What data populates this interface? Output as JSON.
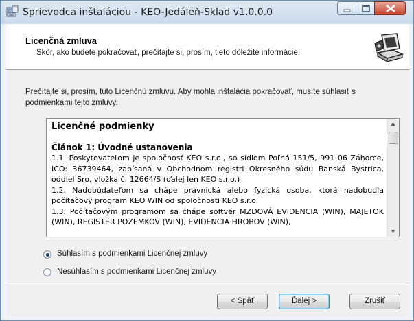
{
  "window": {
    "title": "Sprievodca inštaláciou - KEO-Jedáleň-Sklad v1.0.0.0",
    "controls": {
      "minimize_icon": "minimize-icon",
      "maximize_icon": "maximize-icon",
      "close_icon": "close-icon"
    }
  },
  "header": {
    "title": "Licenčná zmluva",
    "subtitle": "Skôr, ako budete pokračovať, prečítajte si, prosím, tieto dôležité informácie.",
    "icon": "setup-computer-icon"
  },
  "instruction": "Prečítajte si, prosím, túto Licenčnú zmluvu. Aby mohla inštalácia pokračovať, musíte súhlasiť s podmienkami tejto zmluvy.",
  "license": {
    "heading": "Licenčné podmienky",
    "section_title": "Článok 1: Úvodné ustanovenia",
    "paragraphs": [
      "1.1. Poskytovateľom je spoločnosť KEO s.r.o., so sídlom Poľná 151/5, 991 06 Záhorce, IČO: 36739464, zapísaná v Obchodnom registri Okresného súdu Banská Bystrica, oddiel Sro, vložka č. 12664/S (ďalej len KEO s.r.o.)",
      "1.2. Nadobúdateľom sa chápe právnická alebo fyzická osoba, ktorá nadobudla počítačový program KEO WIN od spoločnosti KEO s.r.o.",
      "1.3. Počítačovým programom sa chápe softvér MZDOVÁ EVIDENCIA (WIN), MAJETOK (WIN), REGISTER POZEMKOV (WIN), EVIDENCIA HROBOV (WIN),"
    ]
  },
  "options": [
    {
      "label": "Súhlasím s podmienkami Licenčnej zmluvy",
      "selected": true
    },
    {
      "label": "Nesúhlasím s podmienkami Licenčnej zmluvy",
      "selected": false
    }
  ],
  "buttons": {
    "back": "< Späť",
    "next": "Ďalej >",
    "cancel": "Zrušiť"
  }
}
